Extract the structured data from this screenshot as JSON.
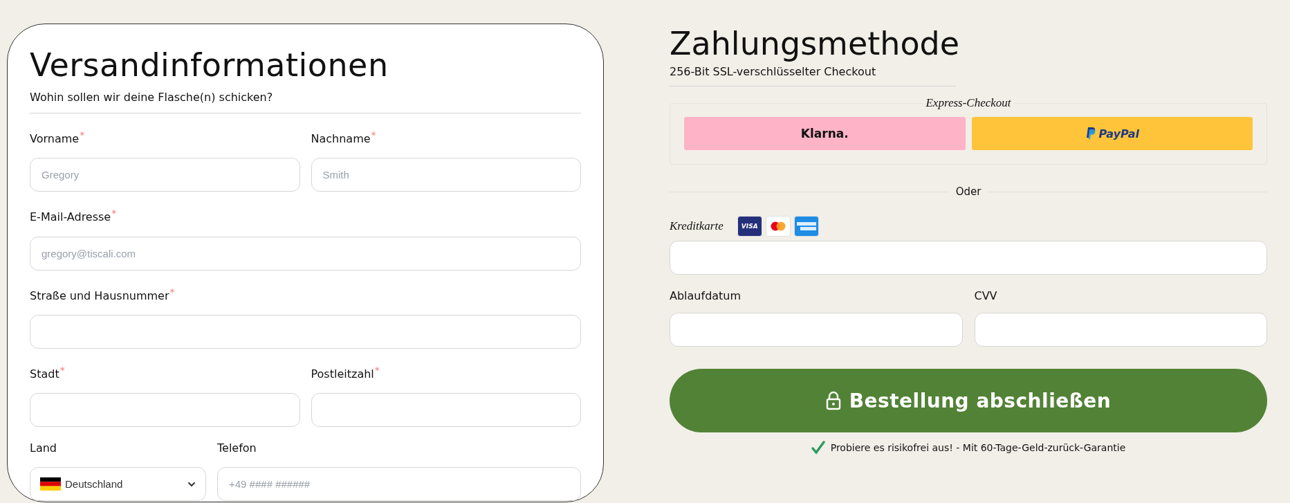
{
  "shipping": {
    "title": "Versandinformationen",
    "subtitle": "Wohin sollen wir deine Flasche(n) schicken?",
    "required_mark": "*",
    "rows": [
      [
        {
          "kind": "text",
          "label": "Vorname",
          "required": true,
          "placeholder": "Gregory"
        },
        {
          "kind": "text",
          "label": "Nachname",
          "required": true,
          "placeholder": "Smith"
        }
      ],
      [
        {
          "kind": "text",
          "label": "E-Mail-Adresse",
          "required": true,
          "placeholder": "gregory@tiscali.com"
        }
      ],
      [
        {
          "kind": "text",
          "label": "Straße und Hausnummer",
          "required": true
        }
      ],
      [
        {
          "kind": "text",
          "label": "Stadt",
          "required": true
        },
        {
          "kind": "text",
          "label": "Postleitzahl",
          "required": true
        }
      ],
      [
        {
          "kind": "select",
          "label": "Land",
          "required": false,
          "value": "Deutschland"
        },
        {
          "kind": "text",
          "label": "Telefon",
          "required": false,
          "placeholder": "+49 #### ######"
        }
      ]
    ]
  },
  "payment": {
    "title": "Zahlungsmethode",
    "subtitle": "256-Bit SSL-verschlüsselter Checkout",
    "express": {
      "legend": "Express-Checkout",
      "buttons": [
        {
          "kind": "klarna",
          "label": "Klarna."
        },
        {
          "kind": "paypal",
          "label": "PayPal"
        }
      ]
    },
    "divider": "Oder",
    "card": {
      "label": "Kreditkarte",
      "networks": [
        {
          "kind": "visa",
          "label": "VISA"
        },
        {
          "kind": "mastercard"
        },
        {
          "kind": "amex"
        }
      ]
    },
    "fields": [
      {
        "label": "Ablaufdatum"
      },
      {
        "label": "CVV"
      }
    ],
    "submit": "Bestellung abschließen",
    "guarantee": "Probiere es risikofrei aus! - Mit 60-Tage-Geld-zurück-Garantie"
  }
}
